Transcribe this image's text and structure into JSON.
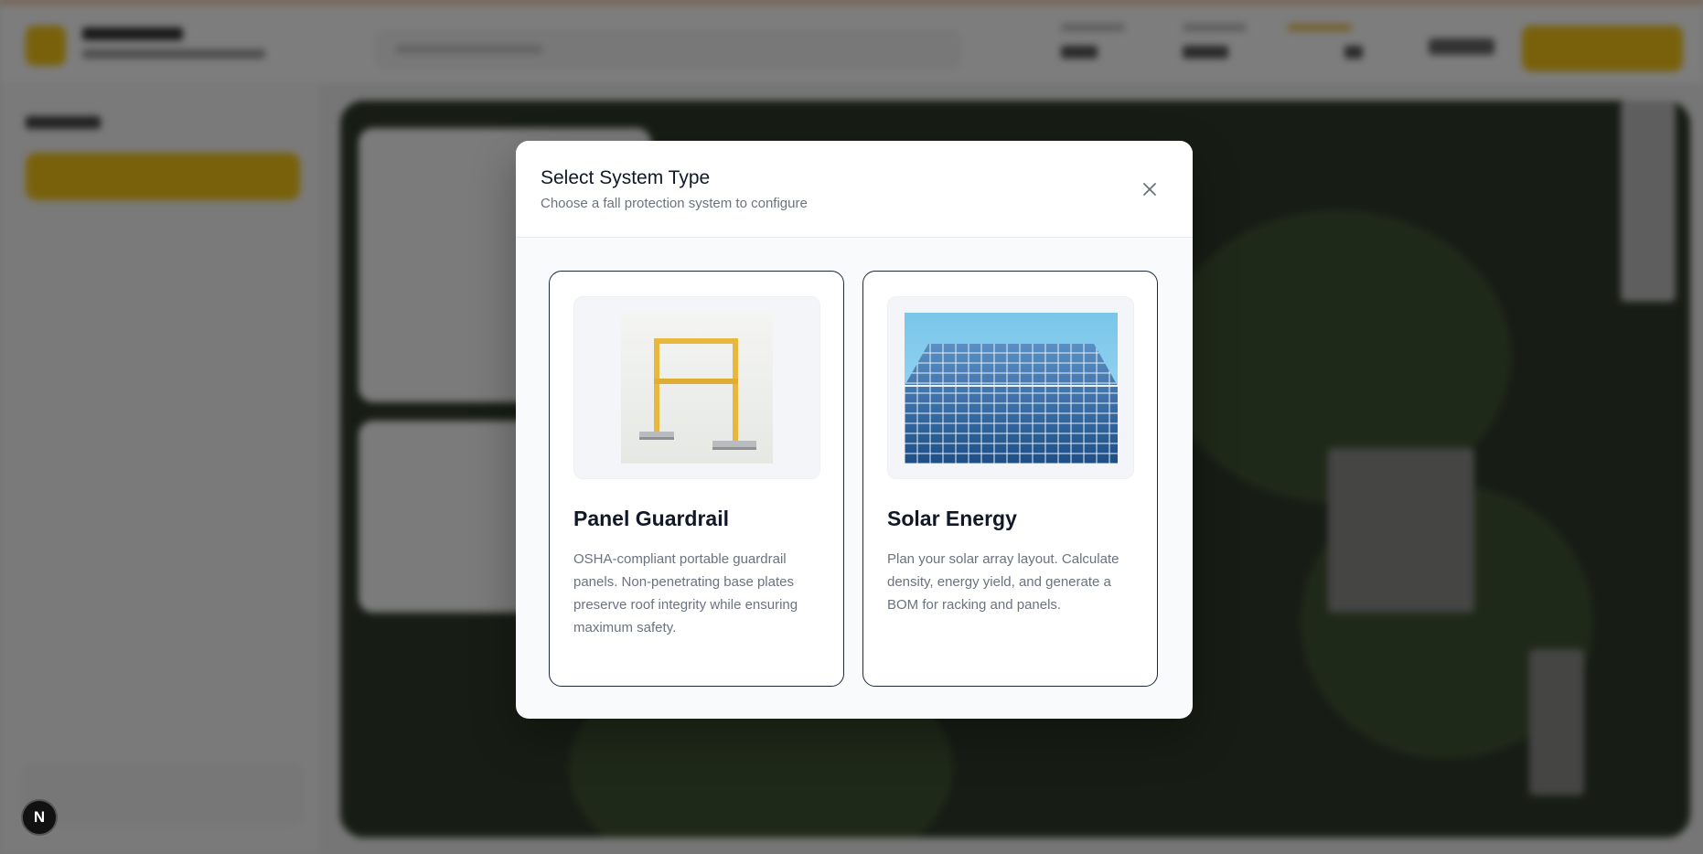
{
  "modal": {
    "title": "Select System Type",
    "subtitle": "Choose a fall protection system to configure",
    "close_icon": "close-icon",
    "options": [
      {
        "title": "Panel Guardrail",
        "description": "OSHA-compliant portable guardrail panels. Non-penetrating base plates preserve roof integrity while ensuring maximum safety.",
        "image": "guardrail-panel-image"
      },
      {
        "title": "Solar Energy",
        "description": "Plan your solar array layout. Calculate density, energy yield, and generate a BOM for racking and panels.",
        "image": "solar-panel-image"
      }
    ]
  },
  "background": {
    "brand_color": "#f2c318",
    "accent_bar_color": "#f0b27a"
  },
  "next_badge": {
    "label": "N"
  }
}
